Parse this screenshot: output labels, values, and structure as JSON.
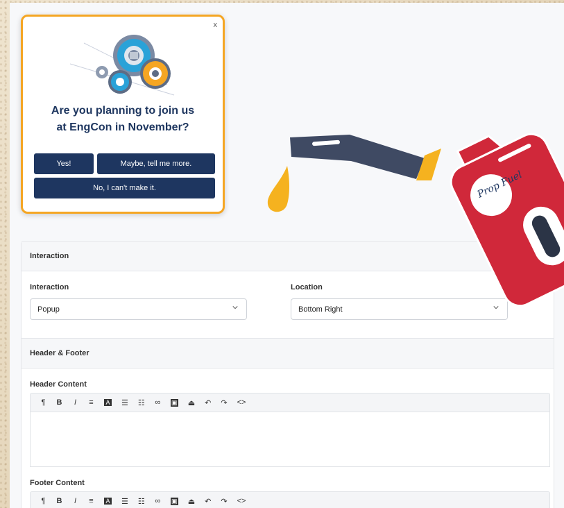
{
  "popup": {
    "close_label": "x",
    "question": "Are you planning to join us at EngCon in November?",
    "buttons": {
      "yes": "Yes!",
      "maybe": "Maybe, tell me more.",
      "no": "No, I can't make it."
    }
  },
  "logo": {
    "text": "Prop Fuel"
  },
  "interaction_section": {
    "heading": "Interaction",
    "interaction_label": "Interaction",
    "interaction_value": "Popup",
    "location_label": "Location",
    "location_value": "Bottom Right"
  },
  "header_footer_section": {
    "heading": "Header & Footer",
    "header_label": "Header Content",
    "footer_label": "Footer Content"
  },
  "toolbar_icons": [
    "pilcrow-icon",
    "bold-icon",
    "italic-icon",
    "align-icon",
    "text-color-icon",
    "bullet-list-icon",
    "numbered-list-icon",
    "link-icon",
    "image-icon",
    "embed-icon",
    "undo-icon",
    "redo-icon",
    "code-icon"
  ],
  "toolbar_glyphs": [
    "¶",
    "B",
    "I",
    "≡",
    "A",
    "☰",
    "☷",
    "∞",
    "▣",
    "⏏",
    "↶",
    "↷",
    "<>"
  ],
  "colors": {
    "accent": "#f5a623",
    "navy": "#1e3660",
    "can_red": "#d0283a",
    "nozzle": "#3f4a63"
  }
}
